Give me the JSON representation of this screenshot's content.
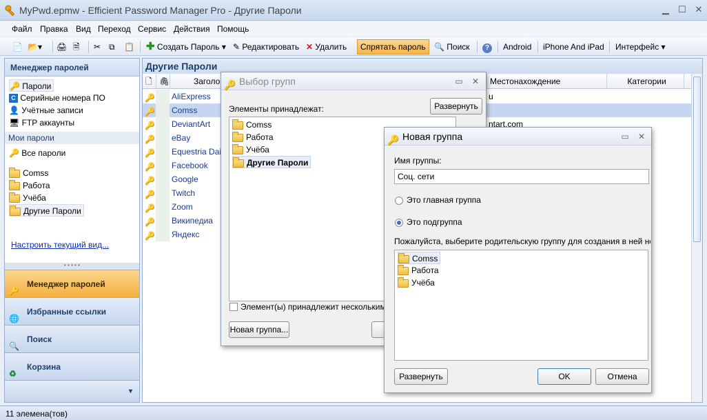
{
  "window": {
    "title": "MyPwd.epmw - Efficient Password Manager Pro - Другие Пароли"
  },
  "menu": [
    "Файл",
    "Правка",
    "Вид",
    "Переход",
    "Сервис",
    "Действия",
    "Помощь"
  ],
  "toolbar": {
    "create": "Создать Пароль",
    "edit": "Редактировать",
    "delete": "Удалить",
    "hide": "Спрятать пароль",
    "search": "Поиск",
    "android": "Android",
    "iphone": "iPhone And iPad",
    "interface": "Интерфейс"
  },
  "sidebar": {
    "header": "Менеджер паролей",
    "items": [
      "Пароли",
      "Серийные номера ПО",
      "Учётные записи",
      "FTP аккаунты"
    ],
    "section": "Мои пароли",
    "all": "Все пароли",
    "groups": [
      "Comss",
      "Работа",
      "Учёба",
      "Другие Пароли"
    ],
    "link": "Настроить текущий вид...",
    "nav": [
      "Менеджер паролей",
      "Избранные ссылки",
      "Поиск",
      "Корзина"
    ]
  },
  "main": {
    "header": "Другие Пароли",
    "columns": {
      "title": "Заголо",
      "location": "Местонахождение",
      "categories": "Категории"
    },
    "rows": [
      {
        "title": "AliExpress",
        "location": "u"
      },
      {
        "title": "Comss",
        "location": ""
      },
      {
        "title": "DeviantArt",
        "location": "ntart.com"
      },
      {
        "title": "eBay",
        "location": ""
      },
      {
        "title": "Equestria Dail",
        "location": ""
      },
      {
        "title": "Facebook",
        "location": ""
      },
      {
        "title": "Google",
        "location": ""
      },
      {
        "title": "Twitch",
        "location": ""
      },
      {
        "title": "Zoom",
        "location": ""
      },
      {
        "title": "Википедиа",
        "location": ""
      },
      {
        "title": "Яндекс",
        "location": ""
      }
    ]
  },
  "status": "11 элемена(тов)",
  "dialog_groups": {
    "title": "Выбор групп",
    "label": "Элементы принадлежат:",
    "expand": "Развернуть",
    "groups": [
      "Comss",
      "Работа",
      "Учёба",
      "Другие Пароли"
    ],
    "checkbox": "Элемент(ы) принадлежит нескольким",
    "new_group": "Новая группа..."
  },
  "dialog_new": {
    "title": "Новая группа",
    "name_label": "Имя группы:",
    "name_value": "Соц. сети",
    "radio_main": "Это главная группа",
    "radio_sub": "Это подгруппа",
    "parent_label": "Пожалуйста, выберите родительскую группу для создания в ней но",
    "groups": [
      "Comss",
      "Работа",
      "Учёба"
    ],
    "expand": "Развернуть",
    "ok": "OK",
    "cancel": "Отмена"
  }
}
